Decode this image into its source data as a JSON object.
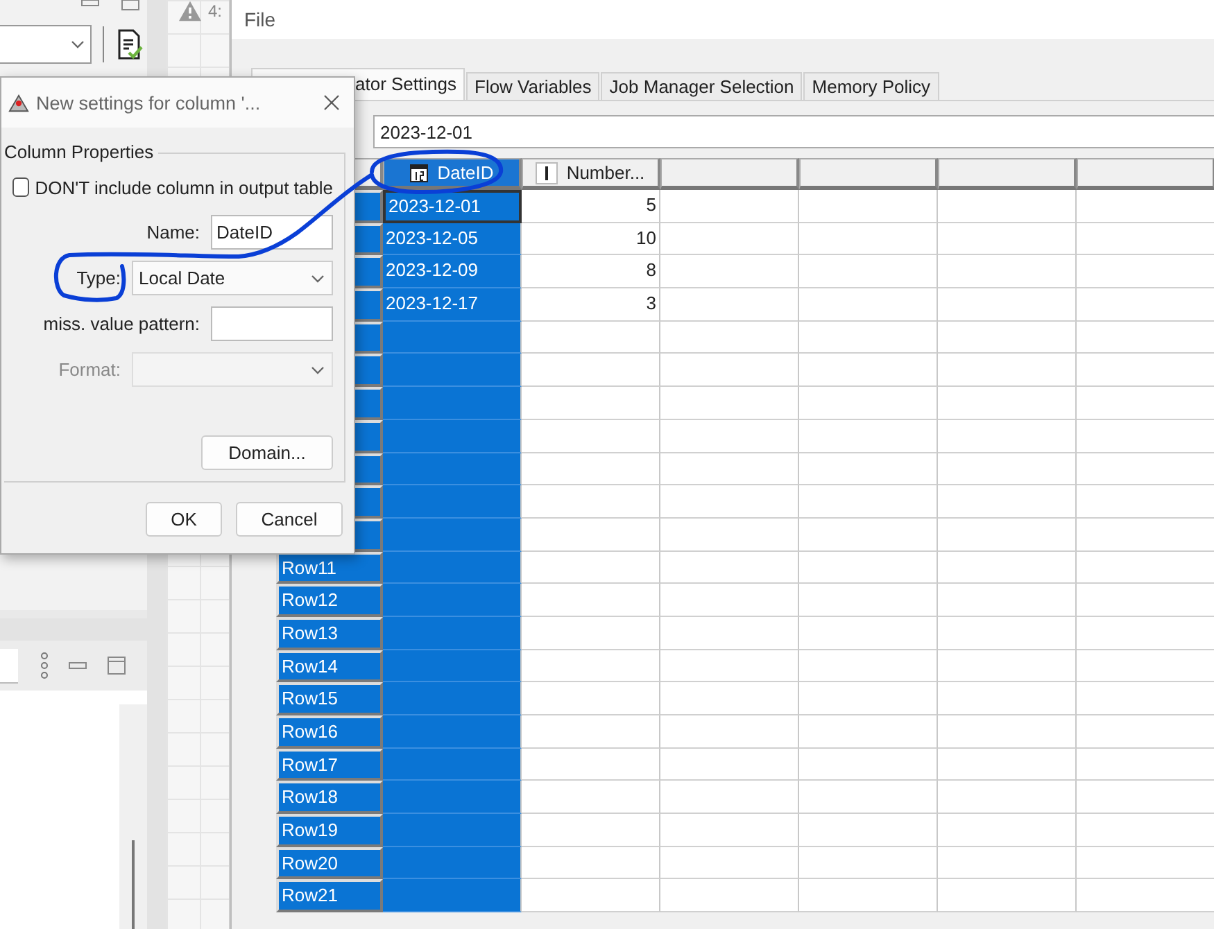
{
  "canvas": {
    "node_label": "4:"
  },
  "main_window": {
    "menu": [
      "File"
    ],
    "tabs": [
      {
        "label": "ator Settings",
        "selected": true
      },
      {
        "label": "Flow Variables",
        "selected": false
      },
      {
        "label": "Job Manager Selection",
        "selected": false
      },
      {
        "label": "Memory Policy",
        "selected": false
      }
    ],
    "cell_editor": {
      "value": "2023-12-01"
    },
    "table": {
      "columns": [
        {
          "kind": "date",
          "name": "DateID",
          "selected": true
        },
        {
          "kind": "int",
          "name": "Number...",
          "selected": false
        },
        {
          "kind": "blank",
          "selected": false
        },
        {
          "kind": "blank",
          "selected": false
        },
        {
          "kind": "blank",
          "selected": false
        },
        {
          "kind": "blank",
          "selected": false
        }
      ],
      "rows": [
        {
          "selected": true,
          "focused": true,
          "cells": [
            "2023-12-01",
            "5"
          ]
        },
        {
          "selected": true,
          "focused": false,
          "cells": [
            "2023-12-05",
            "10"
          ]
        },
        {
          "selected": true,
          "focused": false,
          "cells": [
            "2023-12-09",
            "8"
          ]
        },
        {
          "selected": true,
          "focused": false,
          "cells": [
            "2023-12-17",
            "3"
          ]
        },
        {
          "selected": true,
          "focused": false
        },
        {
          "selected": true,
          "focused": false
        },
        {
          "selected": true,
          "focused": false
        },
        {
          "selected": true,
          "focused": false
        },
        {
          "selected": true,
          "focused": false
        },
        {
          "selected": true,
          "focused": false
        },
        {
          "selected": true,
          "focused": false
        },
        {
          "label": "Row11",
          "selected": true,
          "focused": false
        },
        {
          "label": "Row12",
          "selected": true,
          "focused": false
        },
        {
          "label": "Row13",
          "selected": true,
          "focused": false
        },
        {
          "label": "Row14",
          "selected": true,
          "focused": false
        },
        {
          "label": "Row15",
          "selected": true,
          "focused": false
        },
        {
          "label": "Row16",
          "selected": true,
          "focused": false
        },
        {
          "label": "Row17",
          "selected": true,
          "focused": false
        },
        {
          "label": "Row18",
          "selected": true,
          "focused": false
        },
        {
          "label": "Row19",
          "selected": true,
          "focused": false
        },
        {
          "label": "Row20",
          "selected": true,
          "focused": false
        },
        {
          "label": "Row21",
          "selected": true,
          "focused": false
        }
      ]
    }
  },
  "dialog": {
    "title": "New settings for column '...",
    "group": "Column Properties",
    "exclude_checkbox": {
      "label": "DON'T include column in output table",
      "checked": false
    },
    "fields": [
      {
        "kind": "text",
        "label": "Name:",
        "value": "DateID",
        "disabled": false
      },
      {
        "kind": "combo",
        "label": "Type:",
        "value": "Local Date",
        "disabled": false
      },
      {
        "kind": "text",
        "label": "miss. value pattern:",
        "disabled": false
      },
      {
        "kind": "combo",
        "label": "Format:",
        "disabled": true
      }
    ],
    "domain_button": "Domain...",
    "buttons": [
      "OK",
      "Cancel"
    ]
  }
}
